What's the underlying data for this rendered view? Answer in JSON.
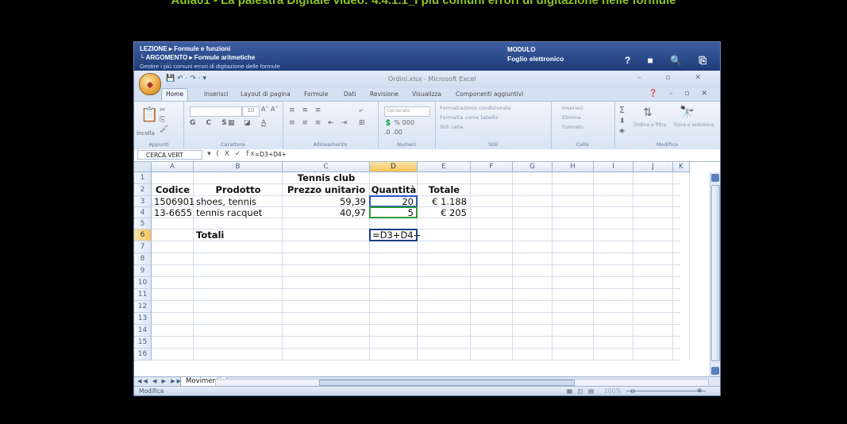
{
  "page_title": "Aula01 - La palestra Digitale video: 4.4.1.1_I più comuni errori di digitazione nelle formule",
  "lesson": {
    "line1": "LEZIONE ▸ Formule e funzioni",
    "line2": "└ ARGOMENTO ▸ Formule aritmetiche",
    "line3": "Gestire i più comuni errori di digitazione delle formule",
    "module_label": "MODULO",
    "module_name": "Foglio elettronico",
    "header_icons": "? ■ 🔍 ⎘"
  },
  "excel": {
    "window_title": "Ordini.xlsx - Microsoft Excel",
    "qat": "💾 ↶ · ↷ · ▾",
    "window_buttons": "– ▫ ✕",
    "tabs": [
      "Home",
      "Inserisci",
      "Layout di pagina",
      "Formule",
      "Dati",
      "Revisione",
      "Visualizza",
      "Componenti aggiuntivi"
    ],
    "tabs_right": "❓ – ▫ ✕",
    "ribbon": {
      "groups": [
        "Appunti",
        "Carattere",
        "Allineamento",
        "Numeri",
        "Stili",
        "Celle",
        "Modifica"
      ],
      "paste_label": "Incolla",
      "font_size": "10",
      "number_format": "Generale",
      "styles": [
        "Formattazione condizionale",
        "Formatta come tabella",
        "Stili cella"
      ],
      "cells": [
        "Inserisci",
        "Elimina",
        "Formato"
      ],
      "edit": [
        "Ordina e filtra",
        "Trova e seleziona"
      ]
    },
    "name_box": "CERCA.VERT",
    "formula_icons": "▾ ( X ✓ fx",
    "formula_text": "=D3+D4+",
    "columns": [
      "A",
      "B",
      "C",
      "D",
      "E",
      "F",
      "G",
      "H",
      "I",
      "J",
      "K"
    ],
    "rows": [
      "1",
      "2",
      "3",
      "4",
      "5",
      "6",
      "7",
      "8",
      "9",
      "10",
      "11",
      "12",
      "13",
      "14",
      "15",
      "16"
    ],
    "cells": {
      "c1": "Tennis club",
      "a2": "Codice",
      "b2": "Prodotto",
      "c2": "Prezzo unitario",
      "d2": "Quantità",
      "e2": "Totale",
      "a3": "1506901",
      "b3": "shoes, tennis",
      "c3": "59,39",
      "d3": "20",
      "e3": "€ 1.188",
      "a4": "13-6655",
      "b4": "tennis racquet",
      "c4": "40,97",
      "d4": "5",
      "e4": "€ 205",
      "b6": "Totali",
      "d6": "=D3+D4+"
    },
    "sheet_nav": "◀◀ ◀ ▶ ▶▶",
    "sheet_tab": "Movimenti",
    "status_mode": "Modifica",
    "status_views": "▦ ◫ ▤",
    "zoom": "100%"
  }
}
